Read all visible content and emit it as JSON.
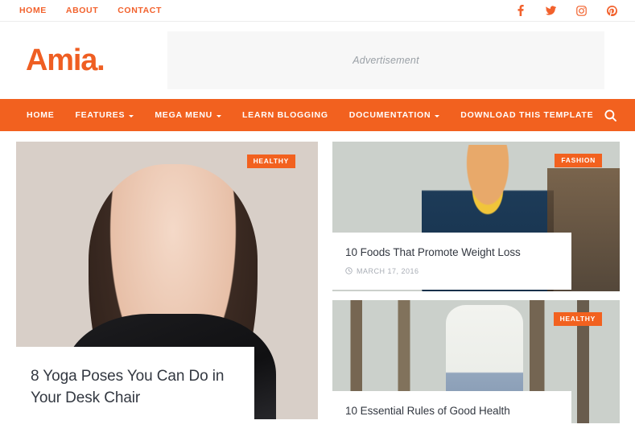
{
  "topbar": {
    "links": [
      {
        "label": "HOME"
      },
      {
        "label": "ABOUT"
      },
      {
        "label": "CONTACT"
      }
    ],
    "socials": [
      {
        "name": "facebook-icon",
        "label": "Facebook"
      },
      {
        "name": "twitter-icon",
        "label": "Twitter"
      },
      {
        "name": "instagram-icon",
        "label": "Instagram"
      },
      {
        "name": "pinterest-icon",
        "label": "Pinterest"
      }
    ]
  },
  "header": {
    "logo": "Amia.",
    "ad_label": "Advertisement"
  },
  "mainnav": {
    "accent_color": "#f2611f",
    "items": [
      {
        "label": "HOME",
        "caret": false
      },
      {
        "label": "FEATURES",
        "caret": true
      },
      {
        "label": "MEGA MENU",
        "caret": true
      },
      {
        "label": "LEARN BLOGGING",
        "caret": false
      },
      {
        "label": "DOCUMENTATION",
        "caret": true
      },
      {
        "label": "DOWNLOAD THIS TEMPLATE",
        "caret": false
      }
    ],
    "search_icon": "search-icon"
  },
  "feature": {
    "badge": "HEALTHY",
    "title": "8 Yoga Poses You Can Do in Your Desk Chair"
  },
  "cards": [
    {
      "badge": "FASHION",
      "title": "10 Foods That Promote Weight Loss",
      "date": "MARCH 17, 2016",
      "date_icon": "clock-icon"
    },
    {
      "badge": "HEALTHY",
      "title": "10 Essential Rules of Good Health",
      "date": "",
      "date_icon": "clock-icon"
    }
  ]
}
